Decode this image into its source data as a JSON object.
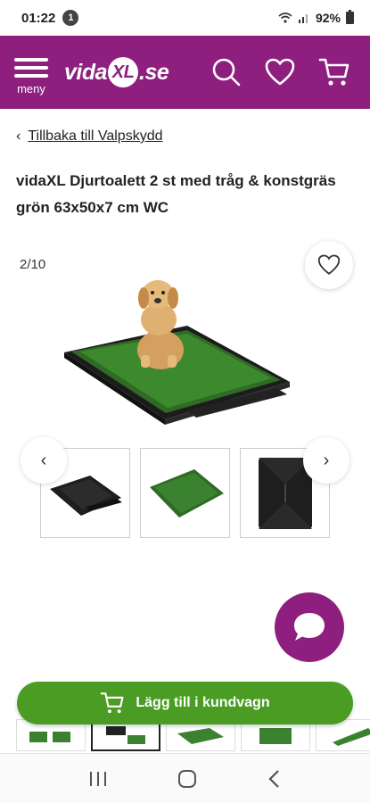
{
  "status": {
    "time": "01:22",
    "notif_count": "1",
    "battery": "92%"
  },
  "header": {
    "menu_label": "meny",
    "logo_prefix": "vida",
    "logo_mid": "XL",
    "logo_suffix": ".se"
  },
  "breadcrumb": {
    "back_label": "Tillbaka till Valpskydd"
  },
  "product": {
    "title": "vidaXL Djurtoalett 2 st med tråg & konstgräs grön 63x50x7 cm WC",
    "image_counter": "2/10"
  },
  "actions": {
    "add_to_cart": "Lägg till i kundvagn"
  },
  "colors": {
    "brand": "#8e1f7f",
    "cta": "#4a9c23"
  }
}
